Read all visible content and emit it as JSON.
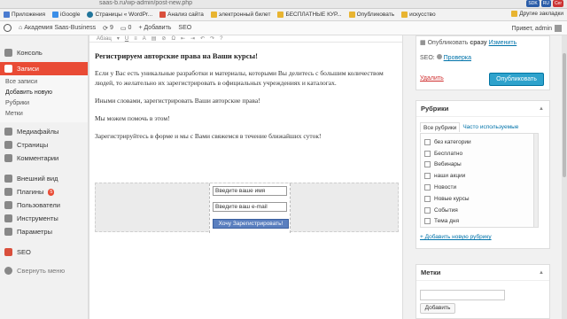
{
  "browser": {
    "url": "saas-b.ru/wp-admin/post-new.php",
    "badges": [
      "SDK",
      "RU",
      "Cer"
    ],
    "bookmarks": [
      {
        "label": "Приложения",
        "color": "#4a7bd0"
      },
      {
        "label": "iGoogle",
        "color": "#3b8ee8"
      },
      {
        "label": "Страницы « WordPr...",
        "color": "#21759b"
      },
      {
        "label": "Анализ сайта",
        "color": "#d94f3c"
      },
      {
        "label": "электронный билет",
        "color": "#e8b431"
      },
      {
        "label": "БЕСПЛАТНЫЕ КУР...",
        "color": "#e8b431"
      },
      {
        "label": "Опубликовать",
        "color": "#e8b431"
      },
      {
        "label": "искусство",
        "color": "#e8b431"
      }
    ],
    "other_bookmarks": "Другие закладки"
  },
  "adminbar": {
    "site_name": "Академия Saas-Business",
    "updates": "9",
    "comments": "0",
    "add": "+ Добавить",
    "seo": "SEO",
    "greeting": "Привет, admin"
  },
  "sidebar": {
    "items": [
      {
        "label": "Консоль",
        "icon": "dashboard-icon"
      },
      {
        "label": "Записи",
        "icon": "posts-icon",
        "active": true
      },
      {
        "label": "Медиафайлы",
        "icon": "media-icon"
      },
      {
        "label": "Страницы",
        "icon": "pages-icon"
      },
      {
        "label": "Комментарии",
        "icon": "comments-icon"
      },
      {
        "label": "Внешний вид",
        "icon": "appearance-icon"
      },
      {
        "label": "Плагины",
        "icon": "plugins-icon",
        "badge": "5"
      },
      {
        "label": "Пользователи",
        "icon": "users-icon"
      },
      {
        "label": "Инструменты",
        "icon": "tools-icon"
      },
      {
        "label": "Параметры",
        "icon": "settings-icon"
      },
      {
        "label": "SEO",
        "icon": "seo-icon"
      },
      {
        "label": "Свернуть меню",
        "icon": "collapse-icon"
      }
    ],
    "submenu": [
      "Все записи",
      "Добавить новую",
      "Рубрики",
      "Метки"
    ]
  },
  "editor": {
    "format": "Абзац",
    "heading": "Регистрируем авторские права на Ваши курсы!",
    "p1": "Если у Вас есть уникальные разработки и материалы, которыми Вы делитесь с большим количеством людей, то желательно их зарегистрировать в официальных учреждениях и каталогах.",
    "p2": "Иными словами, зарегистрировать Ваши авторские права!",
    "p3": "Мы можем помочь в этом!",
    "p4": "Зарегистрируйтесь в форме и мы с Вами свяжемся в течение ближайших суток!",
    "form": {
      "name_placeholder": "Введите ваше имя",
      "email_placeholder": "Введите ваш e-mail",
      "submit": "Хочу Зарегистрировать!"
    }
  },
  "publish": {
    "status_prefix": "Опубликовать",
    "status_strong": "сразу",
    "change": "Изменить",
    "seo_label": "SEO:",
    "seo_link": "Проверка",
    "delete": "Удалить",
    "publish_button": "Опубликовать"
  },
  "categories": {
    "title": "Рубрики",
    "tab_all": "Все рубрики",
    "tab_popular": "Часто используемые",
    "items": [
      "без категории",
      "Бесплатно",
      "Вебинары",
      "наши акции",
      "Новости",
      "Новые курсы",
      "События",
      "Тема дня"
    ],
    "add_link": "+ Добавить новую рубрику"
  },
  "tags": {
    "title": "Метки",
    "add_button": "Добавить"
  }
}
